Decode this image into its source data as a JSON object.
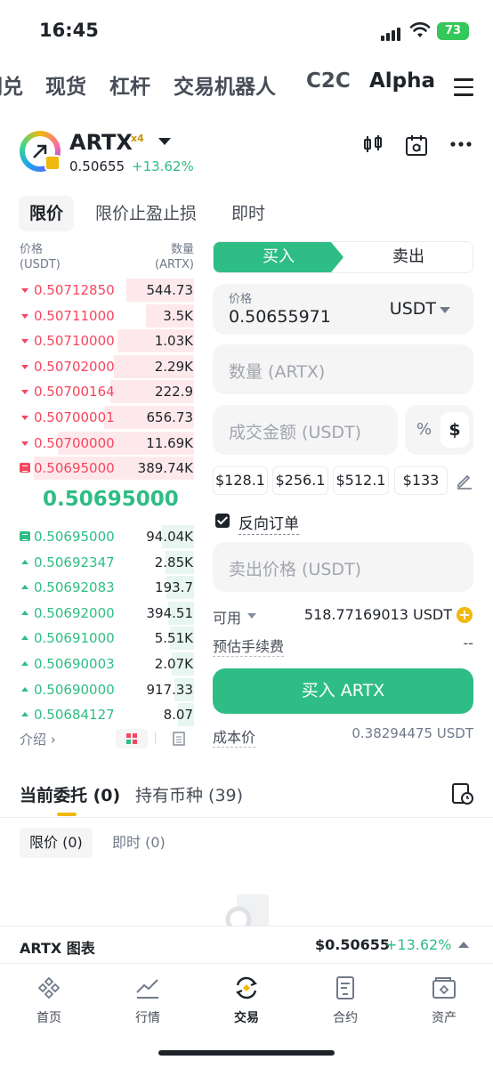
{
  "status_bar": {
    "time": "16:45",
    "battery": "73"
  },
  "nav_tabs": [
    "闪兑",
    "现货",
    "杠杆",
    "交易机器人",
    "C2C",
    "Alpha"
  ],
  "active_nav_tab": "Alpha",
  "token": {
    "symbol": "ARTX",
    "multiplier": "x4",
    "price": "0.50655",
    "change": "+13.62%"
  },
  "order_types": [
    "限价",
    "限价止盈止损",
    "即时"
  ],
  "orderbook": {
    "price_label": "价格",
    "price_unit": "(USDT)",
    "qty_label": "数量",
    "qty_unit": "(ARTX)",
    "asks": [
      {
        "price": "0.50712850",
        "qty": "544.73",
        "depth": 0.42
      },
      {
        "price": "0.50711000",
        "qty": "3.5K",
        "depth": 0.3
      },
      {
        "price": "0.50710000",
        "qty": "1.03K",
        "depth": 0.48
      },
      {
        "price": "0.50702000",
        "qty": "2.29K",
        "depth": 0.5
      },
      {
        "price": "0.50700164",
        "qty": "222.9",
        "depth": 0.52
      },
      {
        "price": "0.50700001",
        "qty": "656.73",
        "depth": 0.56
      },
      {
        "price": "0.50700000",
        "qty": "11.69K",
        "depth": 0.85
      },
      {
        "price": "0.50695000",
        "qty": "389.74K",
        "depth": 1.0
      }
    ],
    "mid_price": "0.50695000",
    "bids": [
      {
        "price": "0.50695000",
        "qty": "94.04K",
        "depth": 0.2
      },
      {
        "price": "0.50692347",
        "qty": "2.85K",
        "depth": 0.18
      },
      {
        "price": "0.50692083",
        "qty": "193.7",
        "depth": 0.17
      },
      {
        "price": "0.50692000",
        "qty": "394.51",
        "depth": 0.16
      },
      {
        "price": "0.50691000",
        "qty": "5.51K",
        "depth": 0.15
      },
      {
        "price": "0.50690003",
        "qty": "2.07K",
        "depth": 0.14
      },
      {
        "price": "0.50690000",
        "qty": "917.33",
        "depth": 0.12
      },
      {
        "price": "0.50684127",
        "qty": "8.07",
        "depth": 0.1
      }
    ],
    "intro": "介绍 ›"
  },
  "trade_panel": {
    "buy_label": "买入",
    "sell_label": "卖出",
    "price_field_label": "价格",
    "price_value": "0.50655971",
    "price_unit": "USDT",
    "qty_placeholder": "数量 (ARTX)",
    "total_placeholder": "成交金额 (USDT)",
    "pct_symbol": "%",
    "dollar_symbol": "$",
    "amount_buttons": [
      "$128.1",
      "$256.1",
      "$512.1",
      "$133"
    ],
    "reverse_order_label": "反向订单",
    "sell_price_placeholder": "卖出价格 (USDT)",
    "available_label": "可用",
    "available_value": "518.77169013 USDT",
    "fee_label": "预估手续费",
    "fee_value": "--",
    "buy_button": "买入 ARTX",
    "cost_label": "成本价",
    "cost_value": "0.38294475 USDT"
  },
  "orders": {
    "tab_open": "当前委托 (0)",
    "tab_holdings": "持有币种 (39)",
    "subtab_limit": "限价 (0)",
    "subtab_instant": "即时 (0)"
  },
  "chart_bar": {
    "label": "ARTX 图表",
    "price": "$0.50655",
    "change": "+13.62%"
  },
  "bottom_nav": [
    "首页",
    "行情",
    "交易",
    "合约",
    "资产"
  ],
  "active_bottom_nav": "交易",
  "colors": {
    "green": "#2ebd85",
    "red": "#f6465d",
    "yellow": "#f0b90b"
  }
}
